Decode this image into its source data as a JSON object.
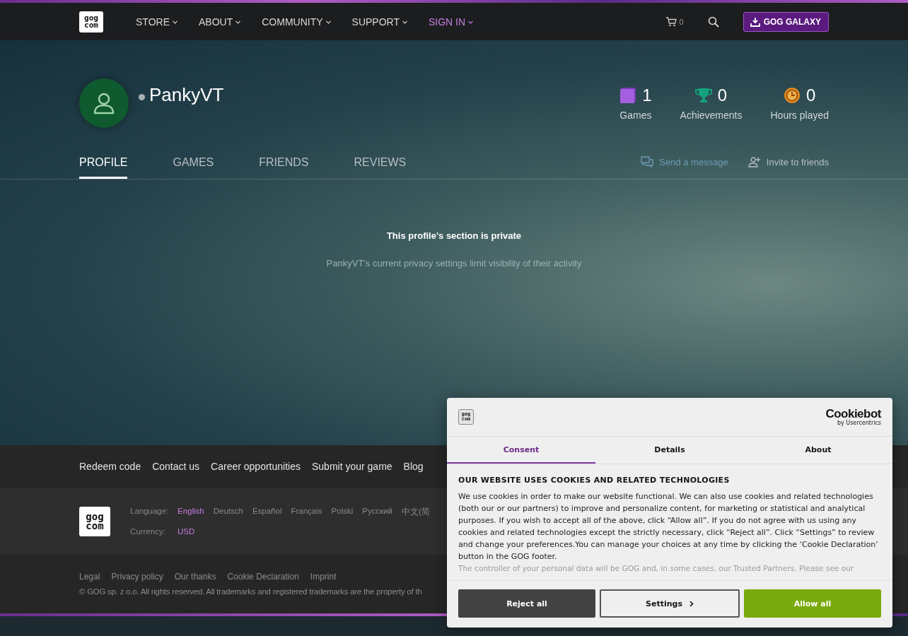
{
  "logo": {
    "top": "gog",
    "bottom": "com"
  },
  "nav": [
    {
      "label": "STORE",
      "kind": "menu"
    },
    {
      "label": "ABOUT",
      "kind": "menu"
    },
    {
      "label": "COMMUNITY",
      "kind": "menu"
    },
    {
      "label": "SUPPORT",
      "kind": "menu"
    },
    {
      "label": "SIGN IN",
      "kind": "account"
    }
  ],
  "cart_count": "0",
  "galaxy_button": "GOG GALAXY",
  "profile": {
    "username": "PankyVT",
    "online": false
  },
  "stats": [
    {
      "kind": "games",
      "value": "1",
      "label": "Games"
    },
    {
      "kind": "achievements",
      "value": "0",
      "label": "Achievements"
    },
    {
      "kind": "hours",
      "value": "0",
      "label": "Hours played"
    }
  ],
  "tabs": [
    {
      "label": "PROFILE",
      "selected": true
    },
    {
      "label": "GAMES",
      "selected": false
    },
    {
      "label": "FRIENDS",
      "selected": false
    },
    {
      "label": "REVIEWS",
      "selected": false
    }
  ],
  "actions": [
    {
      "kind": "message",
      "label": "Send a message"
    },
    {
      "kind": "invite",
      "label": "Invite to friends"
    }
  ],
  "private_notice": {
    "title": "This profile's section is private",
    "text": "PankyVT's current privacy settings limit visibility of their activity"
  },
  "footer_links": [
    "Redeem code",
    "Contact us",
    "Career opportunities",
    "Submit your game",
    "Blog"
  ],
  "footer_logo": {
    "top": "gog",
    "bottom": "com"
  },
  "language_label": "Language:",
  "languages": [
    {
      "label": "English",
      "selected": true
    },
    {
      "label": "Deutsch",
      "selected": false
    },
    {
      "label": "Español",
      "selected": false
    },
    {
      "label": "Français",
      "selected": false
    },
    {
      "label": "Polski",
      "selected": false
    },
    {
      "label": "Русский",
      "selected": false
    },
    {
      "label": "中文(简",
      "selected": false
    }
  ],
  "currency_label": "Currency:",
  "currency": "USD",
  "legal_links": [
    "Legal",
    "Privacy policy",
    "Our thanks",
    "Cookie Declaration",
    "Imprint"
  ],
  "copyright": "© GOG sp. z o.o. All rights reserved. All trademarks and registered trademarks are the property of th",
  "cookie_dialog": {
    "logo": {
      "top": "gog",
      "bottom": "com"
    },
    "brand": "Cookiebot",
    "brand_sub": "by Usercentrics",
    "tabs": [
      {
        "label": "Consent",
        "selected": true
      },
      {
        "label": "Details",
        "selected": false
      },
      {
        "label": "About",
        "selected": false
      }
    ],
    "heading": "OUR WEBSITE USES COOKIES AND RELATED TECHNOLOGIES",
    "paragraphs": [
      "We use cookies in order to make our website functional. We can also use cookies and related technologies (both our or our partners) to improve and personalize content, for marketing or statistical and analytical purposes. If you wish to accept all of the above, click “Allow all”. If you do not agree with us using any cookies and related technologies except the strictly necessary, click “Reject all”. Click “Settings” to review and change your preferences.You can manage your choices at any time by clicking the ‘Cookie Declaration’ button in the GOG footer.",
      "The controller of your personal data will be GOG and, in some cases, our Trusted Partners. Please see our"
    ],
    "buttons": [
      {
        "kind": "reject",
        "label": "Reject all"
      },
      {
        "kind": "settings",
        "label": "Settings"
      },
      {
        "kind": "allow",
        "label": "Allow all"
      }
    ]
  }
}
